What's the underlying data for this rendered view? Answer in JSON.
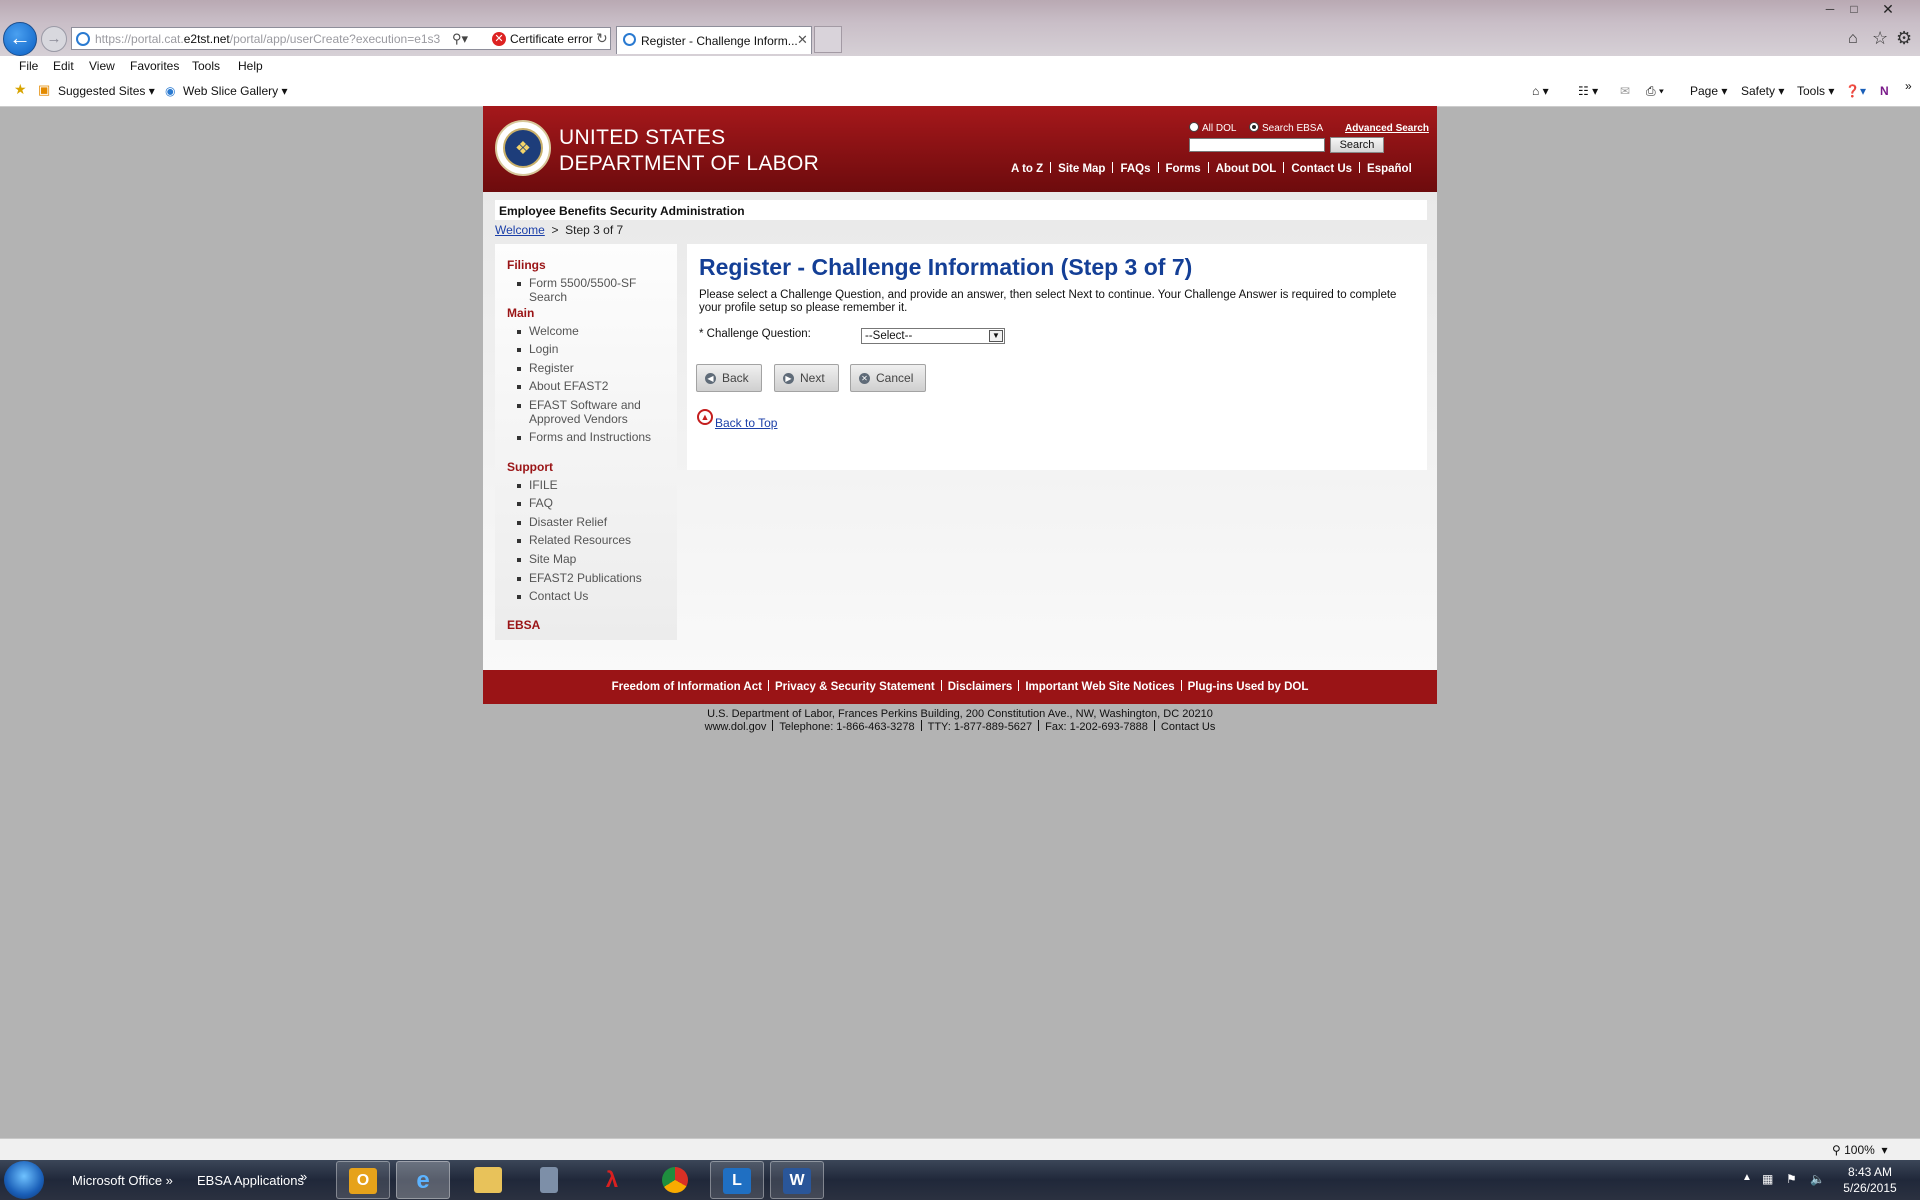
{
  "browser": {
    "address_prefix": "https://portal.cat.",
    "address_domain": "e2tst.net",
    "address_suffix": "/portal/app/userCreate?execution=e1s3",
    "cert_error": "Certificate error",
    "tab_title": "Register - Challenge Inform...",
    "menu": [
      "File",
      "Edit",
      "View",
      "Favorites",
      "Tools",
      "Help"
    ],
    "favorites": [
      "Suggested Sites",
      "Web Slice Gallery"
    ],
    "commands": [
      "Page",
      "Safety",
      "Tools"
    ],
    "zoom": "100%"
  },
  "header": {
    "org_line1": "UNITED STATES",
    "org_line2": "DEPARTMENT OF LABOR",
    "radio_all": "All DOL",
    "radio_ebsa": "Search EBSA",
    "advanced_search": "Advanced Search",
    "search_button": "Search",
    "nav": [
      "A to Z",
      "Site Map",
      "FAQs",
      "Forms",
      "About DOL",
      "Contact Us",
      "Español"
    ]
  },
  "agency": "Employee Benefits Security Administration",
  "breadcrumb": {
    "home": "Welcome",
    "separator": ">",
    "current": "Step 3 of 7"
  },
  "sidebar": {
    "filings_heading": "Filings",
    "filings": [
      "Form 5500/5500-SF Search"
    ],
    "main_heading": "Main",
    "main": [
      "Welcome",
      "Login",
      "Register",
      "About EFAST2",
      "EFAST Software and Approved Vendors",
      "Forms and Instructions"
    ],
    "support_heading": "Support",
    "support": [
      "IFILE",
      "FAQ",
      "Disaster Relief",
      "Related Resources",
      "Site Map",
      "EFAST2 Publications",
      "Contact Us"
    ],
    "ebsa_heading": "EBSA"
  },
  "form": {
    "title": "Register - Challenge Information (Step 3 of 7)",
    "instructions": "Please select a Challenge Question, and provide an answer, then select Next to continue. Your Challenge Answer is required to complete your profile setup so please remember it.",
    "question_label": "* Challenge Question:",
    "question_value": "--Select--",
    "back": "Back",
    "next": "Next",
    "cancel": "Cancel",
    "back_to_top": "Back to Top"
  },
  "footer": {
    "links": [
      "Freedom of Information Act",
      "Privacy & Security Statement",
      "Disclaimers",
      "Important Web Site Notices",
      "Plug-ins Used by DOL"
    ],
    "address": "U.S. Department of Labor, Frances Perkins Building, 200 Constitution Ave., NW, Washington, DC 20210",
    "contact": [
      "www.dol.gov",
      "Telephone: 1-866-463-3278",
      "TTY: 1-877-889-5627",
      "Fax: 1-202-693-7888",
      "Contact Us"
    ]
  },
  "taskbar": {
    "toolbars": [
      "Microsoft Office",
      "EBSA Applications"
    ],
    "time": "8:43 AM",
    "date": "5/26/2015"
  },
  "colors": {
    "dol_red": "#9a1416",
    "title_blue": "#143f96",
    "link_blue": "#1b3fa8"
  }
}
